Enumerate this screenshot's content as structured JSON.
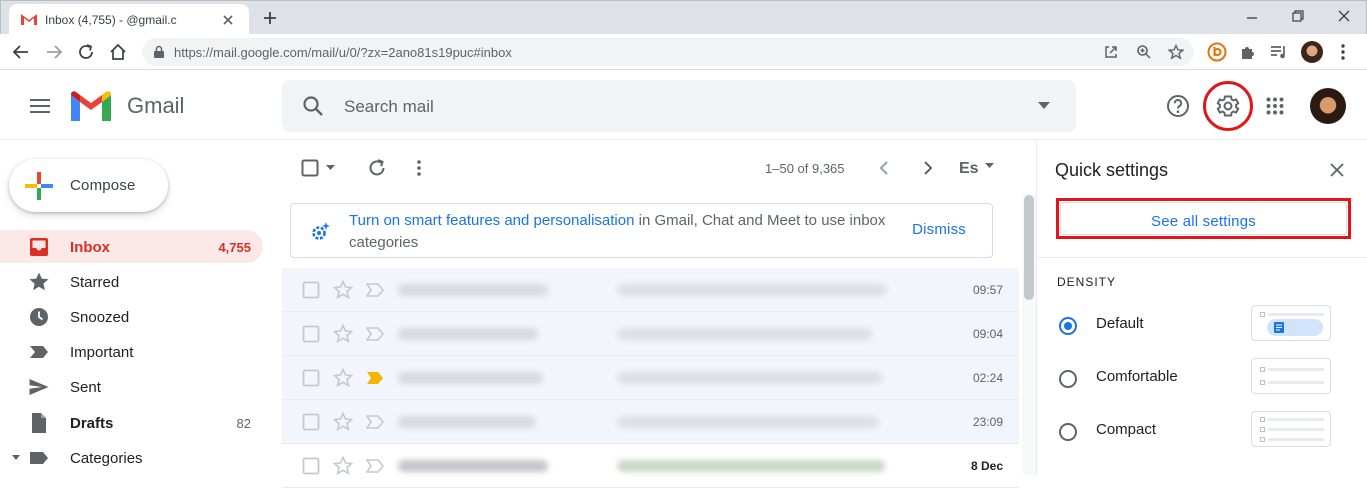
{
  "browser": {
    "tab_title": "Inbox (4,755) -          @gmail.c",
    "url": "https://mail.google.com/mail/u/0/?zx=2ano81s19puc#inbox"
  },
  "header": {
    "app_name": "Gmail",
    "search_placeholder": "Search mail"
  },
  "sidebar": {
    "compose_label": "Compose",
    "items": [
      {
        "label": "Inbox",
        "count": "4,755"
      },
      {
        "label": "Starred",
        "count": ""
      },
      {
        "label": "Snoozed",
        "count": ""
      },
      {
        "label": "Important",
        "count": ""
      },
      {
        "label": "Sent",
        "count": ""
      },
      {
        "label": "Drafts",
        "count": "82"
      },
      {
        "label": "Categories",
        "count": ""
      }
    ]
  },
  "toolbar": {
    "pager": "1–50 of 9,365",
    "language_code": "Es"
  },
  "banner": {
    "link_text": "Turn on smart features and personalisation",
    "rest_text": " in Gmail, Chat and Meet to use inbox categories",
    "dismiss_label": "Dismiss"
  },
  "emails": [
    {
      "date": "09:57"
    },
    {
      "date": "09:04"
    },
    {
      "date": "02:24"
    },
    {
      "date": "23:09"
    },
    {
      "date": "8 Dec"
    }
  ],
  "quick_settings": {
    "title": "Quick settings",
    "see_all_label": "See all settings",
    "density_heading": "DENSITY",
    "density_options": [
      {
        "label": "Default",
        "selected": true
      },
      {
        "label": "Comfortable",
        "selected": false
      },
      {
        "label": "Compact",
        "selected": false
      }
    ]
  },
  "colors": {
    "accent": "#1a73e8",
    "highlight_red": "#e3151a",
    "inbox_active_bg": "#fce8e6",
    "inbox_active_text": "#d93025"
  }
}
